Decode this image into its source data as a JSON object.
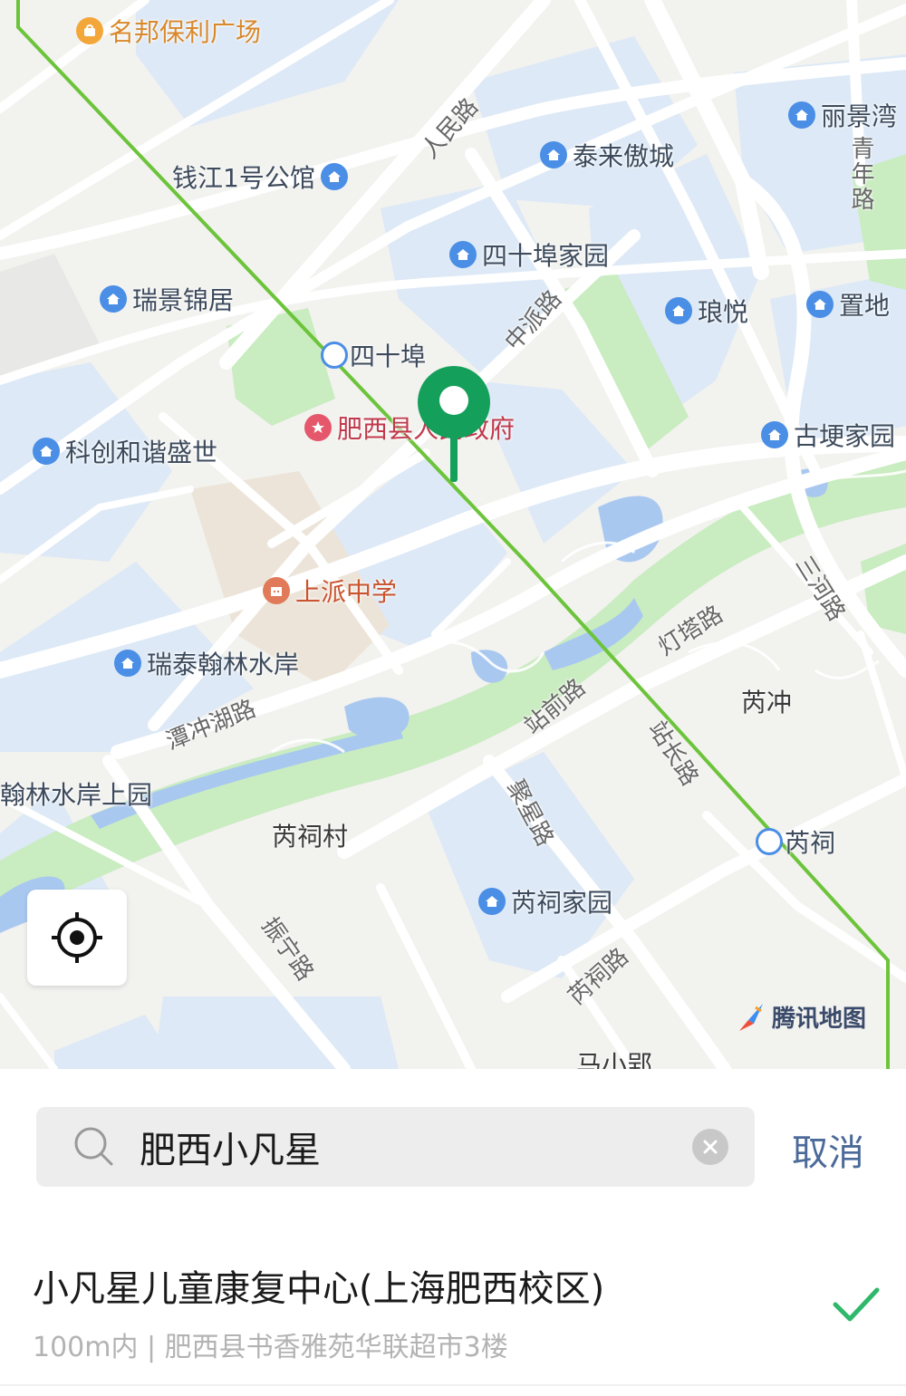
{
  "map": {
    "pois": {
      "mingbang": "名邦保利广场",
      "lijingwan": "丽景湾",
      "qianjiang": "钱江1号公馆",
      "tailai": "泰来傲城",
      "sishibu_home": "四十埠家园",
      "ruijing": "瑞景锦居",
      "langyue": "琅悦",
      "zhidi": "置地",
      "sishibu_station": "四十埠",
      "gov": "肥西县人民政府",
      "kechuang": "科创和谐盛世",
      "gugeng": "古埂家园",
      "shangpai_school": "上派中学",
      "ruitai": "瑞泰翰林水岸",
      "hanlin": "翰林水岸上园",
      "ruici_station": "芮祠",
      "ruici_home": "芮祠家园"
    },
    "roads": {
      "renmin": "人民路",
      "qingnian": "青年路",
      "zhongpai": "中派路",
      "tanchonghu": "潭冲湖路",
      "dengta": "灯塔路",
      "sanhe": "三河路",
      "zhanqian": "站前路",
      "zhanchang": "站长路",
      "juxing": "聚星路",
      "zhenning": "振宁路",
      "ruici_road": "芮祠路"
    },
    "places": {
      "ruichong": "芮冲",
      "ruicicun": "芮祠村",
      "maxiaoying": "马小郢"
    },
    "brand": "腾讯地图"
  },
  "search": {
    "value": "肥西小凡星",
    "placeholder": "",
    "cancel_label": "取消"
  },
  "result": {
    "title": "小凡星儿童康复中心(上海肥西校区)",
    "subtitle": "100m内 | 肥西县书香雅苑华联超市3楼"
  },
  "colors": {
    "route": "#6cc43a",
    "pin": "#14a05a",
    "accent": "#4a6a99",
    "check": "#2fb86b",
    "water": "#a9c8f0",
    "park": "#c9ecc0",
    "block": "#dde9f6"
  }
}
